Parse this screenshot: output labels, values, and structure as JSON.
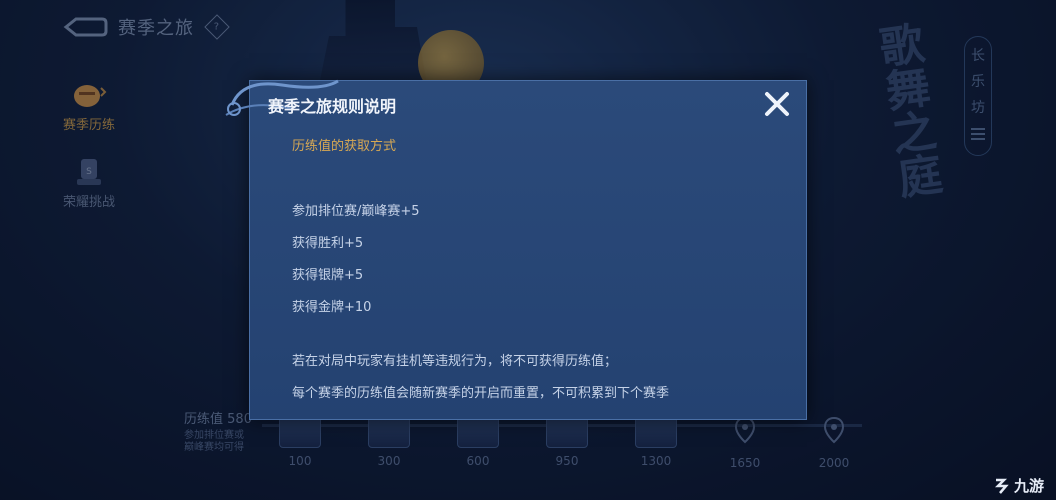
{
  "header": {
    "title": "赛季之旅"
  },
  "left_nav": [
    {
      "label": "赛季历练",
      "active": true
    },
    {
      "label": "荣耀挑战",
      "active": false
    }
  ],
  "decor": {
    "calligraphy": "歌舞之庭",
    "side_tag": [
      "长",
      "乐",
      "坊"
    ]
  },
  "progress": {
    "xp_label": "历练值",
    "xp_value": "580",
    "desc_line1": "参加排位赛或",
    "desc_line2": "巅峰赛均可得",
    "milestones": [
      "100",
      "300",
      "600",
      "950",
      "1300",
      "1650",
      "2000"
    ]
  },
  "dialog": {
    "title": "赛季之旅规则说明",
    "section_heading": "历练值的获取方式",
    "rules": [
      "参加排位赛/巅峰赛+5",
      "获得胜利+5",
      "获得银牌+5",
      "获得金牌+10"
    ],
    "note1": "若在对局中玩家有挂机等违规行为，将不可获得历练值；",
    "note2": "每个赛季的历练值会随新赛季的开启而重置，不可积累到下个赛季"
  },
  "watermark": "九游",
  "colors": {
    "accent_gold": "#d7a853",
    "dialog_bg": "#2b4a7a"
  }
}
